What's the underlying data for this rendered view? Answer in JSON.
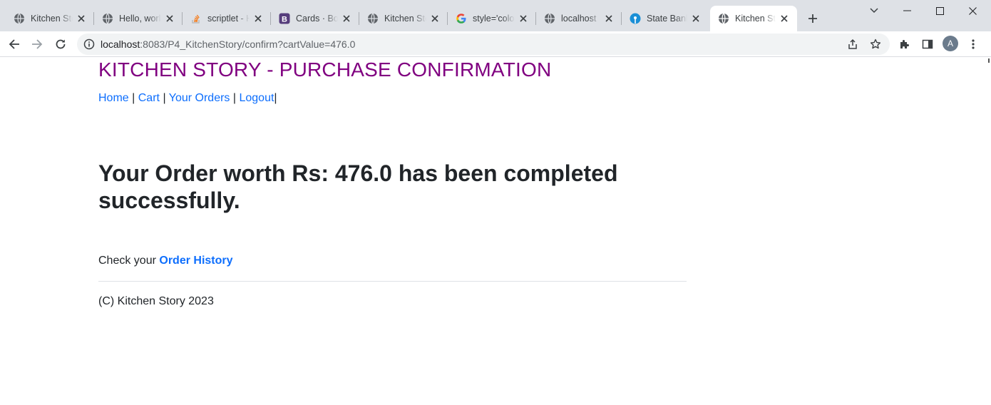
{
  "browser": {
    "tabs": [
      {
        "title": "Kitchen Sto",
        "icon": "globe-icon"
      },
      {
        "title": "Hello, worl",
        "icon": "globe-icon"
      },
      {
        "title": "scriptlet - H",
        "icon": "stackoverflow-icon"
      },
      {
        "title": "Cards · Boo",
        "icon": "bootstrap-icon"
      },
      {
        "title": "Kitchen Sto",
        "icon": "globe-icon"
      },
      {
        "title": "style='colo",
        "icon": "google-icon"
      },
      {
        "title": "localhost",
        "icon": "globe-icon"
      },
      {
        "title": "State Bank",
        "icon": "sbi-icon"
      },
      {
        "title": "Kitchen Sto",
        "icon": "globe-icon"
      }
    ],
    "active_tab_index": 8,
    "address": {
      "host": "localhost",
      "rest": ":8083/P4_KitchenStory/confirm?cartValue=476.0"
    },
    "profile_initial": "A"
  },
  "page": {
    "site_title": "KITCHEN STORY - PURCHASE CONFIRMATION",
    "nav": {
      "home": "Home",
      "cart": "Cart",
      "orders": "Your Orders",
      "logout": "Logout",
      "separator": "|"
    },
    "headline": "Your Order worth Rs: 476.0 has been completed successfully.",
    "history_prefix": "Check your",
    "history_link": "Order History",
    "footer": "(C) Kitchen Story 2023"
  },
  "colors": {
    "title": "#800080",
    "link": "#0d6efd",
    "tabstrip": "#dee1e6"
  }
}
